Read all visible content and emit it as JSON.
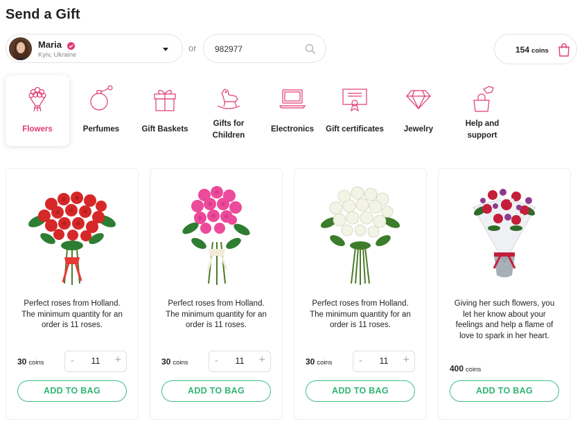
{
  "page": {
    "title": "Send a Gift"
  },
  "recipient": {
    "name": "Maria",
    "location": "Kyiv, Ukraine",
    "verified_icon": "verified-heart-icon"
  },
  "separator": "or",
  "id_search": {
    "value": "982977",
    "icon": "search-icon"
  },
  "wallet": {
    "amount": "154",
    "unit": "coins",
    "icon": "shopping-bag-icon"
  },
  "colors": {
    "accent": "#e0396e",
    "green": "#2fb472"
  },
  "categories": [
    {
      "label": "Flowers",
      "icon": "flowers-icon",
      "active": true
    },
    {
      "label": "Perfumes",
      "icon": "perfume-icon"
    },
    {
      "label": "Gift Baskets",
      "icon": "gift-box-icon"
    },
    {
      "label_line1": "Gifts for",
      "label_line2": "Children",
      "icon": "rocking-horse-icon"
    },
    {
      "label": "Electronics",
      "icon": "laptop-icon"
    },
    {
      "label": "Gift certificates",
      "icon": "certificate-icon"
    },
    {
      "label": "Jewelry",
      "icon": "diamond-icon"
    },
    {
      "label_line1": "Help and",
      "label_line2": "support",
      "icon": "help-bag-icon"
    }
  ],
  "products": [
    {
      "image": "red-roses-bouquet",
      "desc_lines": [
        "Perfect roses from Holland.",
        "The minimum quantity for an",
        "order is 11 roses."
      ],
      "price": "30",
      "unit": "coins",
      "qty": "11",
      "minus": "-",
      "plus": "+",
      "button": "ADD TO BAG"
    },
    {
      "image": "pink-roses-bouquet",
      "desc_lines": [
        "Perfect roses from Holland.",
        "The minimum quantity for an",
        "order is 11 roses."
      ],
      "price": "30",
      "unit": "coins",
      "qty": "11",
      "minus": "-",
      "plus": "+",
      "button": "ADD TO BAG"
    },
    {
      "image": "white-roses-bouquet",
      "desc_lines": [
        "Perfect roses from Holland.",
        "The minimum quantity for an",
        "order is 11 roses."
      ],
      "price": "30",
      "unit": "coins",
      "qty": "11",
      "minus": "-",
      "plus": "+",
      "button": "ADD TO BAG"
    },
    {
      "image": "mixed-flowers-bouquet",
      "desc_lines": [
        "Giving her such flowers, you",
        "let her know about your",
        "feelings and help a flame of",
        "love to spark in her heart."
      ],
      "price": "400",
      "unit": "coins",
      "button": "ADD TO BAG"
    }
  ]
}
